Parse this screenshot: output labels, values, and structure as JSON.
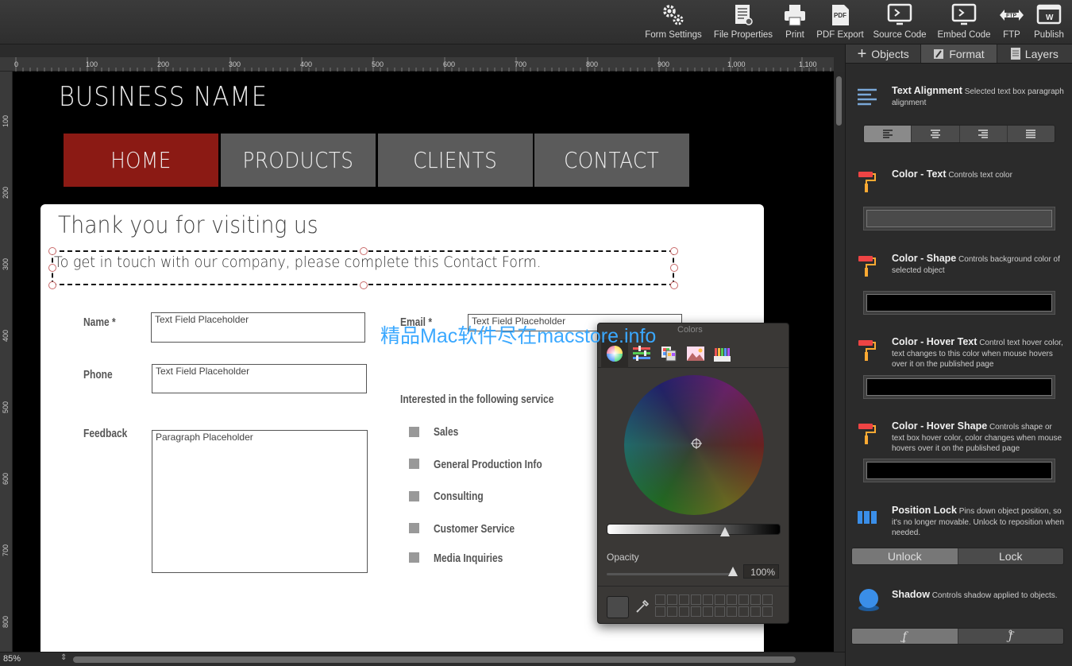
{
  "toolbar": {
    "items": [
      {
        "label": "Form Settings",
        "icon": "gears-icon"
      },
      {
        "label": "File Properties",
        "icon": "file-properties-icon"
      },
      {
        "label": "Print",
        "icon": "printer-icon"
      },
      {
        "label": "PDF Export",
        "icon": "pdf-icon"
      },
      {
        "label": "Source Code",
        "icon": "source-code-icon"
      },
      {
        "label": "Embed Code",
        "icon": "embed-code-icon"
      },
      {
        "label": "FTP",
        "icon": "ftp-icon"
      },
      {
        "label": "Publish",
        "icon": "publish-icon"
      }
    ]
  },
  "ruler": {
    "top": [
      "0",
      "100",
      "200",
      "300",
      "400",
      "500",
      "600",
      "700",
      "800",
      "900",
      "1,000",
      "1,100"
    ],
    "left": [
      "100",
      "200",
      "300",
      "400",
      "500",
      "600",
      "700",
      "800"
    ]
  },
  "canvas": {
    "business_name": "BUSINESS NAME",
    "nav": [
      "HOME",
      "PRODUCTS",
      "CLIENTS",
      "CONTACT"
    ],
    "nav_active_color": "#8b1a14",
    "nav_color": "#5b5b5b",
    "heading": "Thank you for visiting us",
    "intro": "To get in touch with our company, please complete this Contact Form.",
    "form": {
      "name_label": "Name *",
      "name_placeholder": "Text Field Placeholder",
      "phone_label": "Phone",
      "phone_placeholder": "Text Field Placeholder",
      "feedback_label": "Feedback",
      "feedback_placeholder": "Paragraph Placeholder",
      "email_label": "Email *",
      "email_placeholder": "Text Field Placeholder",
      "services_heading": "Interested in the following service",
      "services": [
        "Sales",
        "General Production Info",
        "Consulting",
        "Customer Service",
        "Media Inquiries"
      ]
    }
  },
  "watermark": "精品Mac软件尽在macstore.info",
  "color_picker": {
    "title": "Colors",
    "tabs": [
      "color-wheel-icon",
      "color-sliders-icon",
      "color-palettes-icon",
      "image-palettes-icon",
      "pencils-icon"
    ],
    "opacity_label": "Opacity",
    "opacity_value": "100%",
    "opacity": 1.0
  },
  "status": {
    "zoom": "85%"
  },
  "panel": {
    "tabs": [
      {
        "label": "Objects",
        "icon": "plus-icon"
      },
      {
        "label": "Format",
        "icon": "format-icon"
      },
      {
        "label": "Layers",
        "icon": "layers-icon"
      }
    ],
    "active_tab": "Format",
    "sections": {
      "text_alignment": {
        "title": "Text Alignment",
        "desc": "Selected text box paragraph alignment"
      },
      "color_text": {
        "title": "Color - Text",
        "desc": "Controls text color",
        "value": "#4a4a4a"
      },
      "color_shape": {
        "title": "Color - Shape",
        "desc": "Controls background color of selected object",
        "value": "#000000"
      },
      "color_hover_text": {
        "title": "Color - Hover Text",
        "desc": "Control text hover color, text changes to this color when mouse hovers over it on the published page",
        "value": "#000000"
      },
      "color_hover_shape": {
        "title": "Color - Hover Shape",
        "desc": "Controls shape or text box hover color, color changes when mouse hovers over it on the published page",
        "value": "#000000"
      },
      "position_lock": {
        "title": "Position Lock",
        "desc": "Pins down object position, so it's no longer movable.  Unlock to reposition when needed.",
        "unlock": "Unlock",
        "lock": "Lock"
      },
      "shadow": {
        "title": "Shadow",
        "desc": "Controls shadow applied to objects."
      }
    }
  }
}
